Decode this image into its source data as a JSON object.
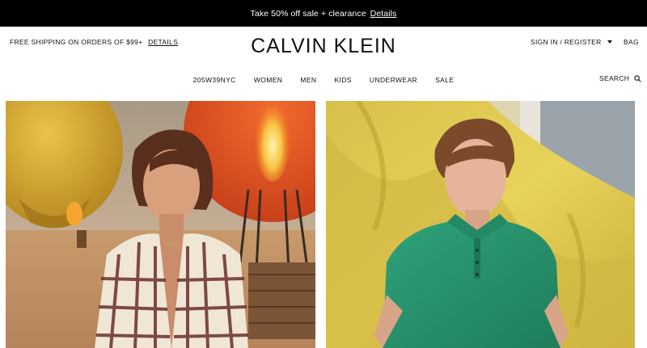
{
  "promo": {
    "text": "Take 50% off sale + clearance",
    "link": "Details"
  },
  "header": {
    "shipping_text": "FREE SHIPPING ON ORDERS OF $99+",
    "shipping_link": "DETAILS",
    "logo": "CALVIN KLEIN",
    "account_label": "SIGN IN / REGISTER",
    "bag_label": "BAG"
  },
  "nav": {
    "items": [
      {
        "label": "205W39NYC"
      },
      {
        "label": "WOMEN"
      },
      {
        "label": "MEN"
      },
      {
        "label": "KIDS"
      },
      {
        "label": "UNDERWEAR"
      },
      {
        "label": "SALE"
      }
    ],
    "search_label": "SEARCH"
  },
  "icons": [
    "chevron-down-icon",
    "search-icon"
  ],
  "colors": {
    "promo_bg": "#000000",
    "text": "#111111",
    "background": "#ffffff"
  },
  "hero": {
    "left_image": "woman-checked-blazer-hot-air-balloons",
    "right_image": "man-green-polo-yellow-fabric"
  }
}
